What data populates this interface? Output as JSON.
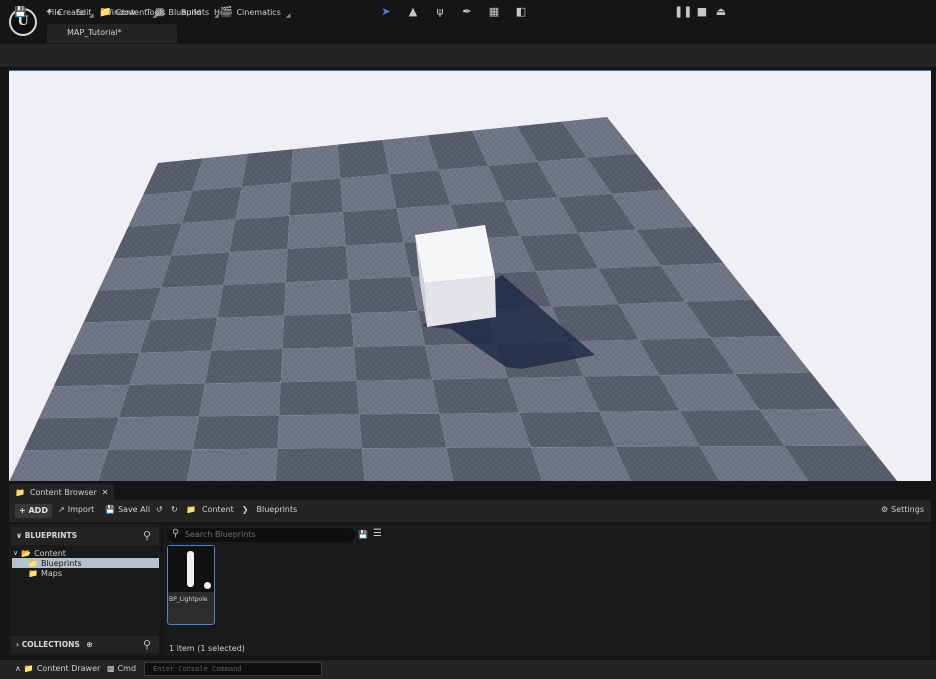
{
  "menu": {
    "logo": "U",
    "items": [
      "File",
      "Edit",
      "Window",
      "Tools",
      "Build",
      "Help"
    ]
  },
  "map_tab": "MAP_Tutorial*",
  "toolbar": {
    "create": "Create",
    "content": "Content",
    "blueprints": "Blueprints",
    "cinematics": "Cinematics"
  },
  "content_browser": {
    "tab_label": "Content Browser",
    "add": "+ ADD",
    "import": "Import",
    "save_all": "Save All",
    "breadcrumb": [
      "Content",
      "Blueprints"
    ],
    "settings": "Settings",
    "blueprints_header": "BLUEPRINTS",
    "tree": [
      {
        "label": "Content",
        "indent": 0
      },
      {
        "label": "Blueprints",
        "indent": 1
      },
      {
        "label": "Maps",
        "indent": 1
      }
    ],
    "collections_header": "COLLECTIONS",
    "search_placeholder": "Search Blueprints",
    "asset_name": "BP_Lightpole",
    "status": "1 item (1 selected)"
  },
  "bottom": {
    "drawer": "Content Drawer",
    "cmd": "Cmd",
    "console_placeholder": "Enter Console Command"
  },
  "colors": {
    "accent": "#3e8ad6",
    "selection": "#b3c2cc",
    "panel": "#242424",
    "background": "#151515"
  }
}
